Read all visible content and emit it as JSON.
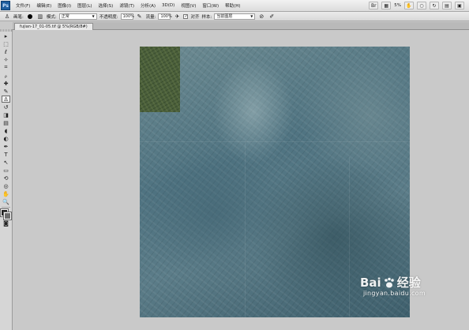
{
  "app": {
    "logo": "Ps"
  },
  "menubar": {
    "items": [
      "文件(F)",
      "编辑(E)",
      "图像(I)",
      "图层(L)",
      "选择(S)",
      "滤镜(T)",
      "分析(A)",
      "3D(D)",
      "视图(V)",
      "窗口(W)",
      "帮助(H)"
    ],
    "zoom": "5%",
    "icons": [
      "bridge-icon",
      "mini-bridge-icon",
      "zoom-level-icon",
      "hand-icon",
      "zoom-icon",
      "rotate-icon",
      "arrange-documents-icon",
      "screen-mode-icon"
    ]
  },
  "options": {
    "brush_label": "画笔:",
    "mode_label": "模式:",
    "mode_value": "正常",
    "opacity_label": "不透明度:",
    "opacity_value": "100%",
    "flow_label": "流量:",
    "flow_value": "100%",
    "align_label": "对齐",
    "sample_label": "样本:",
    "sample_value": "当前图层"
  },
  "document": {
    "tab_title": "fujian-17_01-05.tif @ 5%(RGB/8#)"
  },
  "toolbox": {
    "tools": [
      {
        "name": "move-tool-icon",
        "glyph": "▸"
      },
      {
        "name": "marquee-tool-icon",
        "glyph": "⬚"
      },
      {
        "name": "lasso-tool-icon",
        "glyph": "ℓ"
      },
      {
        "name": "magic-wand-tool-icon",
        "glyph": "✧"
      },
      {
        "name": "crop-tool-icon",
        "glyph": "⌗"
      },
      {
        "name": "eyedropper-tool-icon",
        "glyph": "ᵨ"
      },
      {
        "name": "healing-brush-tool-icon",
        "glyph": "✚"
      },
      {
        "name": "brush-tool-icon",
        "glyph": "✎"
      },
      {
        "name": "clone-stamp-tool-icon",
        "glyph": "♙"
      },
      {
        "name": "history-brush-tool-icon",
        "glyph": "↺"
      },
      {
        "name": "eraser-tool-icon",
        "glyph": "◨"
      },
      {
        "name": "gradient-tool-icon",
        "glyph": "▤"
      },
      {
        "name": "blur-tool-icon",
        "glyph": "◖"
      },
      {
        "name": "dodge-tool-icon",
        "glyph": "◐"
      },
      {
        "name": "pen-tool-icon",
        "glyph": "✒"
      },
      {
        "name": "type-tool-icon",
        "glyph": "T"
      },
      {
        "name": "path-selection-tool-icon",
        "glyph": "↖"
      },
      {
        "name": "shape-tool-icon",
        "glyph": "▭"
      },
      {
        "name": "3d-rotate-tool-icon",
        "glyph": "⟲"
      },
      {
        "name": "3d-orbit-tool-icon",
        "glyph": "◎"
      },
      {
        "name": "hand-tool-icon",
        "glyph": "✋"
      },
      {
        "name": "zoom-tool-icon",
        "glyph": "🔍"
      }
    ],
    "active_index": 8
  },
  "watermark": {
    "brand": "Bai",
    "brand_suffix": "经验",
    "url": "jingyan.baidu.com"
  }
}
